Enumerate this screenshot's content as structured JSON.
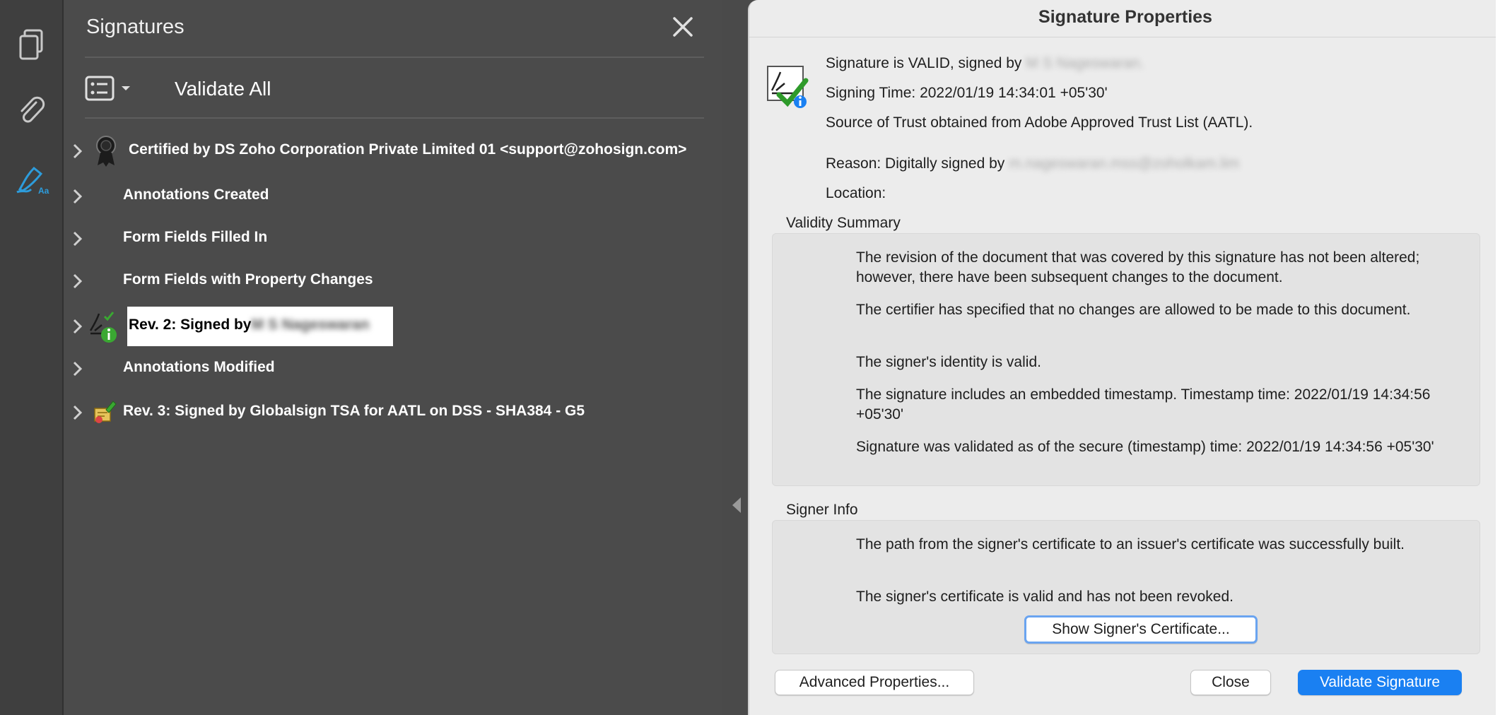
{
  "panel": {
    "title": "Signatures",
    "validate_all": "Validate All",
    "items": [
      {
        "label": "Certified by DS Zoho Corporation Private Limited 01 <support@zohosign.com>"
      },
      {
        "label": "Annotations Created"
      },
      {
        "label": "Form Fields Filled In"
      },
      {
        "label": "Form Fields with Property Changes"
      },
      {
        "label": "Rev. 2: Signed by",
        "redacted": "M S Nageswaran"
      },
      {
        "label": "Annotations Modified"
      },
      {
        "label": "Rev. 3: Signed by Globalsign TSA for AATL on DSS - SHA384 - G5"
      }
    ]
  },
  "dialog": {
    "title": "Signature Properties",
    "status_prefix": "Signature is VALID, signed by",
    "status_signer_redacted": "M S Nageswaran.",
    "signing_time": "Signing Time:  2022/01/19 14:34:01 +05'30'",
    "source_of_trust": "Source of Trust obtained from Adobe Approved Trust List (AATL).",
    "reason_prefix": "Reason:  Digitally signed by",
    "reason_redacted": "m.nageswaran.mss@zoholkam.lim",
    "location": "Location:",
    "validity_summary": {
      "heading": "Validity Summary",
      "paragraphs": [
        "The revision of the document that was covered by this signature has not been altered; however, there have been subsequent changes to the document.",
        "The certifier has specified that no changes are allowed to be made to this document.",
        "The signer's identity is valid.",
        "The signature includes an embedded timestamp. Timestamp time: 2022/01/19 14:34:56 +05'30'",
        "Signature was validated as of the secure (timestamp) time: 2022/01/19 14:34:56 +05'30'"
      ]
    },
    "signer_info": {
      "heading": "Signer Info",
      "paragraphs": [
        "The path from the signer's certificate to an issuer's certificate was successfully built.",
        "The signer's certificate is valid and has not been revoked."
      ],
      "show_cert_button": "Show Signer's Certificate..."
    },
    "buttons": {
      "advanced": "Advanced Properties...",
      "close": "Close",
      "validate": "Validate Signature"
    }
  },
  "colors": {
    "panel_bg": "#4b4b4b",
    "toolbar_bg": "#3f3f3f",
    "accent_blue": "#1a80f2",
    "sign_tool_blue": "#2d9cdb",
    "valid_green": "#3aa832"
  }
}
